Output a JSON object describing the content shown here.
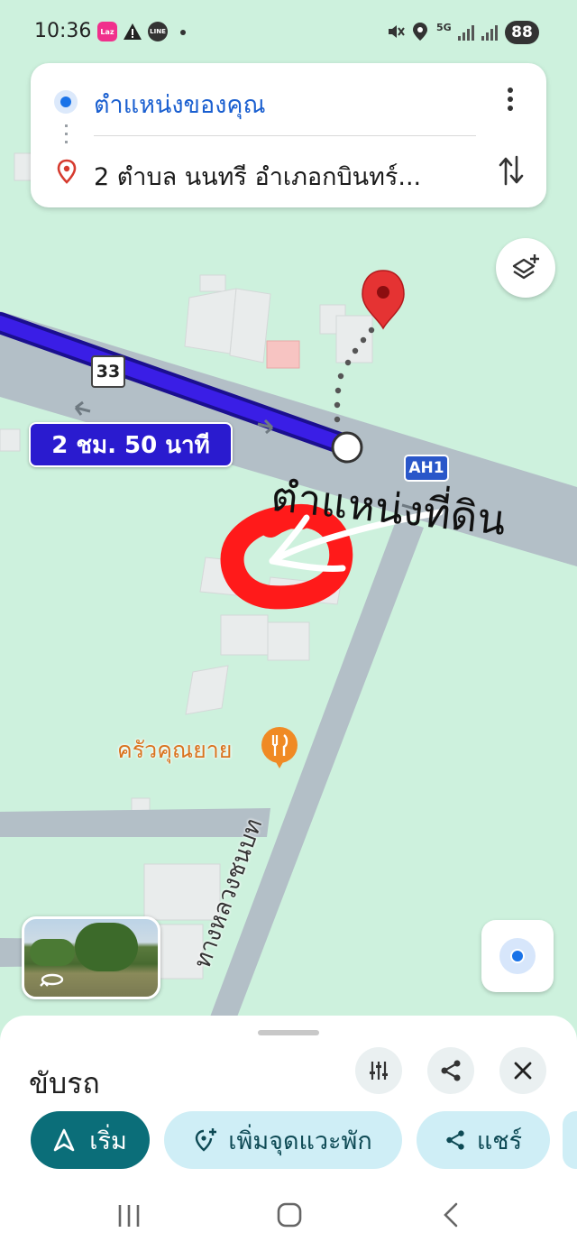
{
  "status_bar": {
    "time": "10:36",
    "lazada_badge": "Laz",
    "line_badge": "LINE",
    "network": "5G",
    "battery": "88"
  },
  "route": {
    "from": "ตำแหน่งของคุณ",
    "to": "2 ตำบล นนทรี อำเภอกบินทร์..."
  },
  "map": {
    "route_time_label": "2 ชม. 50 นาที",
    "highway_33": "33",
    "highway_ah1": "AH1",
    "annotation": "ตำแหน่งที่ดิน",
    "restaurant_name": "ครัวคุณยาย",
    "road_name": "ทางหลวงชนบท",
    "route_color": "#3a1ee6",
    "annotation_color": "#ff1a1a"
  },
  "sheet": {
    "mode": "ขับรถ",
    "chips": {
      "start": "เริ่ม",
      "add_stop": "เพิ่มจุดแวะพัก",
      "share": "แชร์"
    },
    "accent": "#0b6e79"
  }
}
